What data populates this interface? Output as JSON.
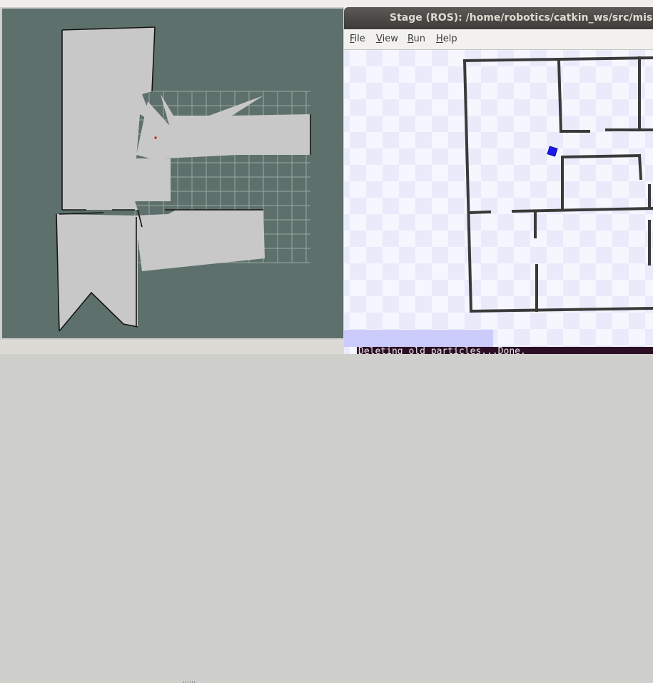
{
  "window": {
    "title": "Stage (ROS): /home/robotics/catkin_ws/src/mission",
    "menus": [
      {
        "mnemonic": "F",
        "rest": "ile"
      },
      {
        "mnemonic": "V",
        "rest": "iew"
      },
      {
        "mnemonic": "R",
        "rest": "un"
      },
      {
        "mnemonic": "H",
        "rest": "elp"
      }
    ]
  },
  "terminal": {
    "text": "Deleting old particles...Done."
  },
  "colors": {
    "rviz_background": "#5e706b",
    "map_free": "#c8c8c8",
    "map_wall": "#151515",
    "stage_robot": "#1a1af0",
    "stage_wall": "#3a3a3a"
  }
}
